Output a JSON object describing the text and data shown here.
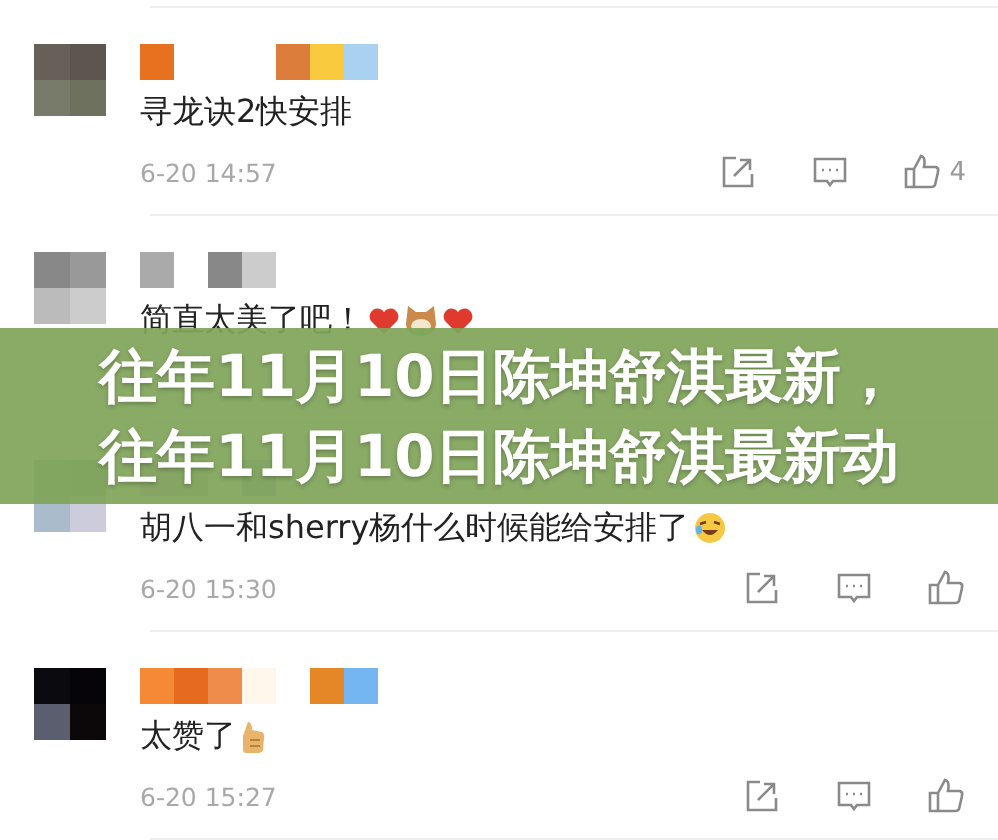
{
  "comments": [
    {
      "text": "寻龙诀2快安排",
      "time": "6-20 14:57",
      "likes": "4"
    },
    {
      "text": "简直太美了吧！",
      "emoji": [
        {
          "kind": "heart"
        },
        {
          "kind": "cat"
        },
        {
          "kind": "heart"
        }
      ]
    },
    {
      "text": "胡八一和sherry杨什么时候能给安排了",
      "emoji": [
        {
          "kind": "laugh"
        }
      ],
      "time": "6-20 15:30"
    },
    {
      "text": "太赞了",
      "emoji": [
        {
          "kind": "thumb"
        }
      ],
      "time": "6-20 15:27"
    }
  ],
  "banner": {
    "lines": [
      "往年11月10日陈坤舒淇最新，",
      "往年11月10日陈坤舒淇最新动"
    ]
  }
}
